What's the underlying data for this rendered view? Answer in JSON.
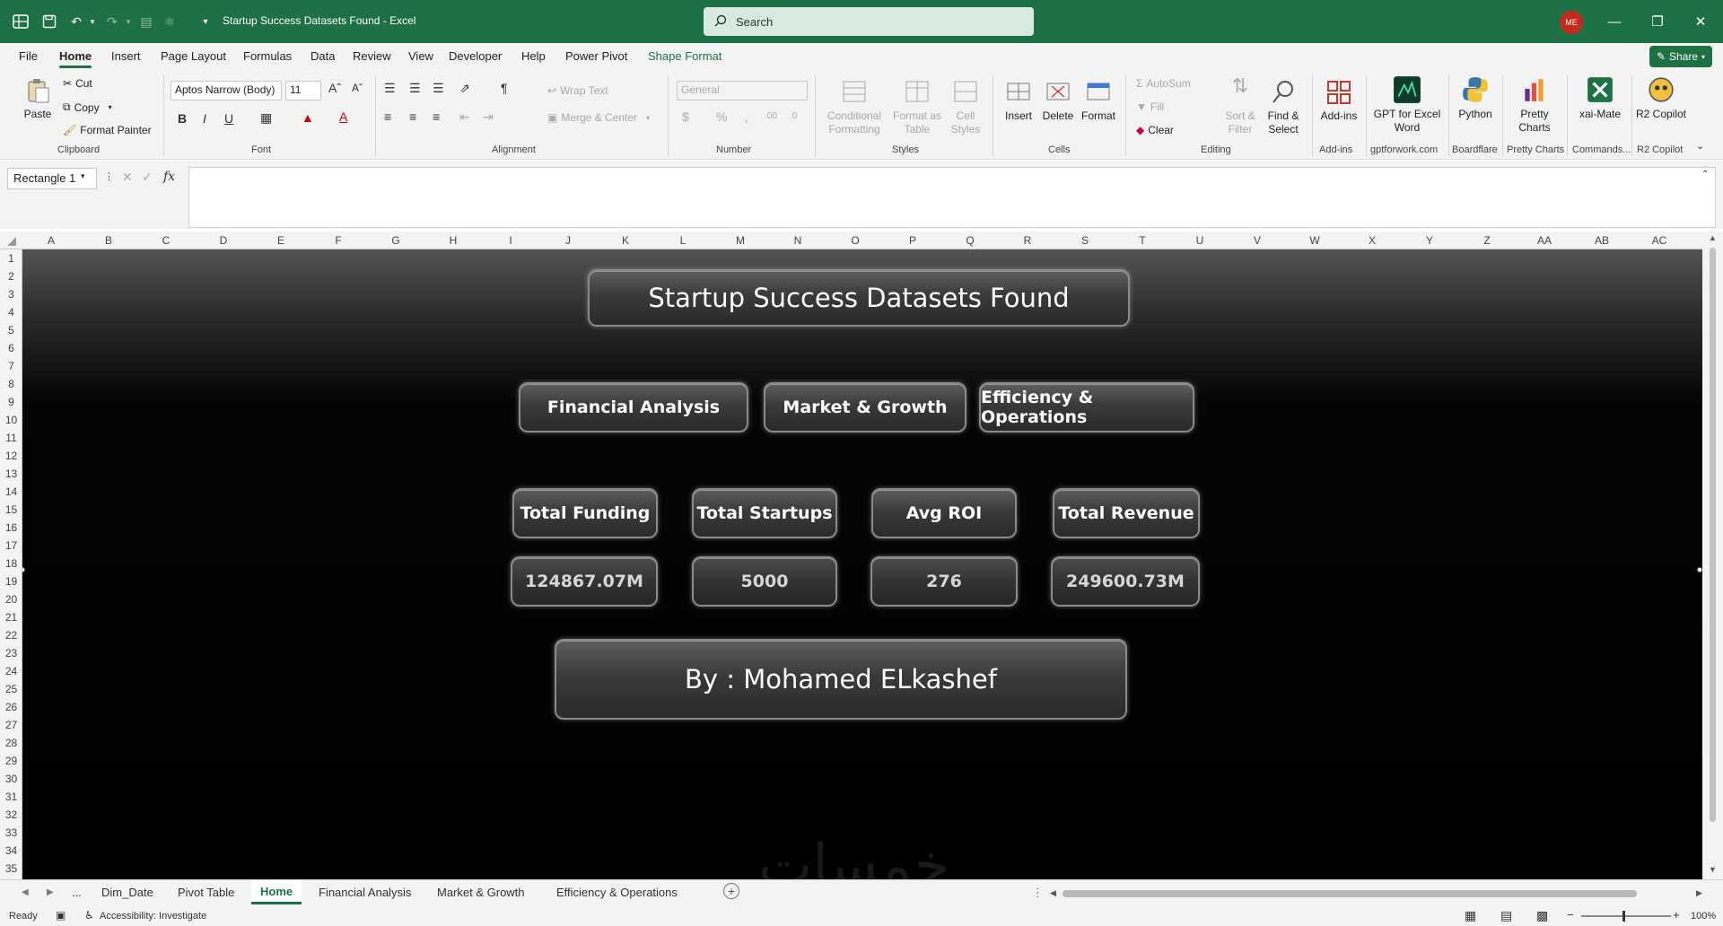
{
  "titlebar": {
    "doc_title": "Startup Success Datasets Found  -  Excel",
    "search_placeholder": "Search",
    "avatar_initials": "ME",
    "accent_color": "#1e7145"
  },
  "menu": {
    "items": [
      "File",
      "Home",
      "Insert",
      "Page Layout",
      "Formulas",
      "Data",
      "Review",
      "View",
      "Developer",
      "Help",
      "Power Pivot",
      "Shape Format"
    ],
    "active": "Home",
    "share_label": "Share"
  },
  "ribbon": {
    "clipboard": {
      "paste": "Paste",
      "cut": "Cut",
      "copy": "Copy",
      "format_painter": "Format Painter",
      "label": "Clipboard"
    },
    "font": {
      "family": "Aptos Narrow (Body)",
      "size": "11",
      "label": "Font"
    },
    "alignment": {
      "wrap_text": "Wrap Text",
      "merge_center": "Merge & Center",
      "label": "Alignment"
    },
    "number": {
      "format": "General",
      "label": "Number"
    },
    "styles": {
      "conditional": "Conditional Formatting",
      "format_table": "Format as Table",
      "cell_styles": "Cell Styles",
      "label": "Styles"
    },
    "cells": {
      "insert": "Insert",
      "delete": "Delete",
      "format": "Format",
      "label": "Cells"
    },
    "editing": {
      "autosum": "AutoSum",
      "fill": "Fill",
      "clear": "Clear",
      "sort_filter": "Sort & Filter",
      "find_select": "Find & Select",
      "label": "Editing"
    },
    "addins": [
      {
        "name": "Add-ins",
        "group": "Add-ins"
      },
      {
        "name": "GPT for Excel Word",
        "group": "gptforwork.com"
      },
      {
        "name": "Python",
        "group": "Boardflare"
      },
      {
        "name": "Pretty Charts",
        "group": "Pretty Charts"
      },
      {
        "name": "xai-Mate",
        "group": "Commands..."
      },
      {
        "name": "R2 Copilot",
        "group": "R2 Copilot"
      }
    ]
  },
  "formula_bar": {
    "name_box": "Rectangle 1",
    "fx": "fx",
    "content": ""
  },
  "columns": [
    "A",
    "B",
    "C",
    "D",
    "E",
    "F",
    "G",
    "H",
    "I",
    "J",
    "K",
    "L",
    "M",
    "N",
    "O",
    "P",
    "Q",
    "R",
    "S",
    "T",
    "U",
    "V",
    "W",
    "X",
    "Y",
    "Z",
    "AA",
    "AB",
    "AC"
  ],
  "rows": [
    "1",
    "2",
    "3",
    "4",
    "5",
    "6",
    "7",
    "8",
    "9",
    "10",
    "11",
    "12",
    "13",
    "14",
    "15",
    "16",
    "17",
    "18",
    "19",
    "20",
    "21",
    "22",
    "23",
    "24",
    "25",
    "26",
    "27",
    "28",
    "29",
    "30",
    "31",
    "32",
    "33",
    "34",
    "35"
  ],
  "dashboard": {
    "title": "Startup Success Datasets Found",
    "nav": [
      "Financial Analysis",
      "Market & Growth",
      "Efficiency & Operations"
    ],
    "kpis": [
      {
        "label": "Total Funding",
        "value": "124867.07M"
      },
      {
        "label": "Total Startups",
        "value": "5000"
      },
      {
        "label": "Avg ROI",
        "value": "276"
      },
      {
        "label": "Total Revenue",
        "value": "249600.73M"
      }
    ],
    "author": "By : Mohamed ELkashef",
    "watermark": "خمسات"
  },
  "sheets": {
    "tabs": [
      "Dim_Date",
      "Pivot Table",
      "Home",
      "Financial Analysis",
      "Market & Growth",
      "Efficiency & Operations"
    ],
    "active": "Home",
    "more": "..."
  },
  "status": {
    "ready": "Ready",
    "accessibility": "Accessibility: Investigate",
    "zoom": "100%"
  }
}
